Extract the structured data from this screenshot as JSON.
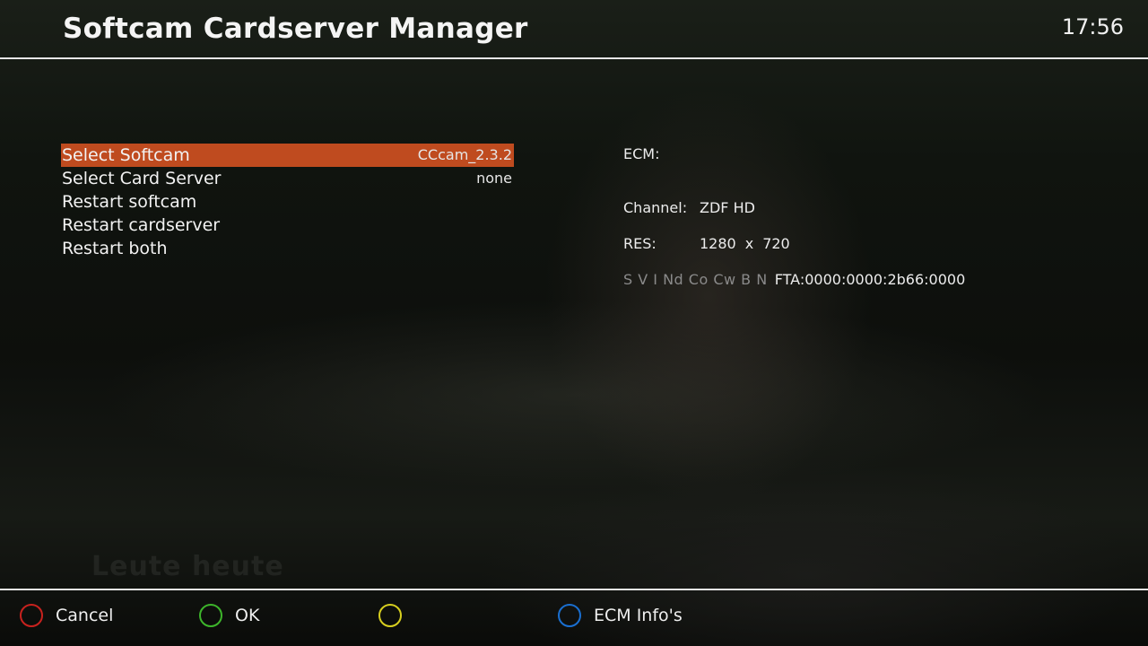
{
  "header": {
    "title": "Softcam Cardserver Manager",
    "clock": "17:56"
  },
  "background": {
    "watermark": "Leute heute"
  },
  "menu": {
    "items": [
      {
        "label": "Select Softcam",
        "value": "CCcam_2.3.2",
        "selected": true
      },
      {
        "label": "Select Card Server",
        "value": "none",
        "selected": false
      },
      {
        "label": "Restart softcam",
        "value": "",
        "selected": false
      },
      {
        "label": "Restart cardserver",
        "value": "",
        "selected": false
      },
      {
        "label": "Restart both",
        "value": "",
        "selected": false
      }
    ]
  },
  "info": {
    "ecm_label": "ECM:",
    "channel_label": "Channel:",
    "channel_value": "ZDF HD",
    "res_label": "RES:",
    "res_width": "1280",
    "res_x": "x",
    "res_height": "720",
    "caid_flags": "S V I Nd Co Cw B N",
    "caid_value": "FTA:0000:0000:2b66:0000"
  },
  "footer": {
    "red_label": "Cancel",
    "green_label": "OK",
    "yellow_label": "",
    "blue_label": "ECM Info's"
  },
  "colors": {
    "selection": "#bf4b1f",
    "red": "#c8221e",
    "green": "#3db52b",
    "yellow": "#d7cf1f",
    "blue": "#1a6fd0"
  }
}
